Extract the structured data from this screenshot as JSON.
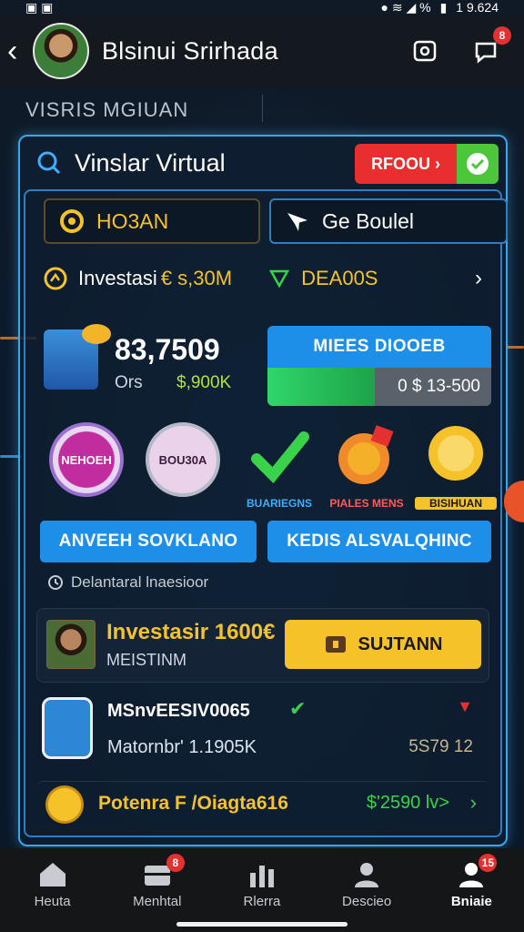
{
  "status_bar": {
    "time": "1 9.624"
  },
  "header": {
    "title": "Blsinui Srirhada",
    "message_badge": "8"
  },
  "section_label": "VISRIS MGIUAN",
  "panel": {
    "title": "Vinslar Virtual",
    "action_label": "RFOOU ›",
    "tabs": [
      {
        "label": "HO3AN",
        "icon": "coin-icon"
      },
      {
        "label": "Ge Boulel",
        "icon": "paper-plane-icon"
      }
    ],
    "invest_row": {
      "label": "Investasi",
      "value": "€ s,30M",
      "deal_label": "DEA00S"
    },
    "stats": {
      "amount": "83,7509",
      "sub_label": "Ors",
      "sub_value": "$,900K"
    },
    "progress": {
      "title": "MIEES DIOOEB",
      "value": "0 $ 13-500",
      "fraction": 0.48
    },
    "circles": [
      {
        "label": "NEHOEH"
      },
      {
        "label": "BOU30A"
      }
    ],
    "rewards": [
      {
        "label": "BUARIEGNS",
        "icon": "check-badge-icon"
      },
      {
        "label": "PIALES MENS",
        "icon": "fire-coin-icon"
      },
      {
        "label": "BISIHUAN",
        "icon": "lightbulb-icon"
      }
    ],
    "wide_buttons": [
      "ANVEEH SOVKLANO",
      "KEDIS ALSVALQHINC"
    ],
    "hint": "Delantaral lnaesioor",
    "featured": {
      "title": "Investasir 1600€",
      "subtitle": "MEISTINM",
      "cta": "SUJTANN"
    },
    "item": {
      "title": "MSnvEESIV0065",
      "subtitle": "Matornbr' 1.1905K",
      "value": "5S79 12"
    },
    "footer_row": {
      "title": "Potenra F /Oiagta616",
      "value": "$'2590 lv>"
    }
  },
  "bottom_nav": [
    {
      "label": "Heuta",
      "icon": "home-icon",
      "badge": ""
    },
    {
      "label": "Menhtal",
      "icon": "chest-icon",
      "badge": "8"
    },
    {
      "label": "Rlerra",
      "icon": "chart-icon",
      "badge": ""
    },
    {
      "label": "Descieo",
      "icon": "person-icon",
      "badge": ""
    },
    {
      "label": "Bniaie",
      "icon": "profile-icon",
      "badge": "15"
    }
  ],
  "colors": {
    "accent": "#1d8fe8",
    "gold": "#f5c22a",
    "danger": "#e33030",
    "success": "#39d24a"
  }
}
